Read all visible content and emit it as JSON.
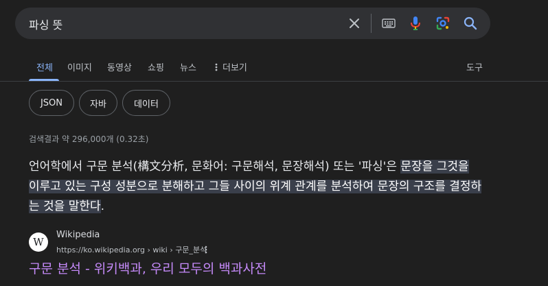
{
  "search": {
    "query": "파싱 뜻"
  },
  "search_icons": [
    "close-icon",
    "keyboard-icon",
    "microphone-icon",
    "lens-icon",
    "search-icon"
  ],
  "tabs": [
    {
      "label": "전체",
      "active": true
    },
    {
      "label": "이미지"
    },
    {
      "label": "동영상"
    },
    {
      "label": "쇼핑"
    },
    {
      "label": "뉴스"
    },
    {
      "label": "더보기"
    }
  ],
  "tools_label": "도구",
  "chips": [
    "JSON",
    "자바",
    "데이터"
  ],
  "result_stats": "검색결과 약 296,000개 (0.32초)",
  "snippet": {
    "plain": "언어학에서 구문 분석(構文分析, 문화어: 구문해석, 문장해석) 또는 '파싱'은 ",
    "highlight": "문장을 그것을 이루고 있는 구성 성분으로 분해하고 그들 사이의 위계 관계를 분석하여 문장의 구조를 결정하는 것을 말한다",
    "end": "."
  },
  "result": {
    "favicon_letter": "W",
    "site_name": "Wikipedia",
    "url": "https://ko.wikipedia.org › wiki › 구문_분석",
    "title": "구문 분석 - 위키백과, 우리 모두의 백과사전"
  },
  "colors": {
    "background": "#1f1f1f",
    "search_bar": "#303134",
    "link_active": "#8ab4f8",
    "visited_title": "#c58af9",
    "highlight_bg": "#3a3f4b"
  }
}
